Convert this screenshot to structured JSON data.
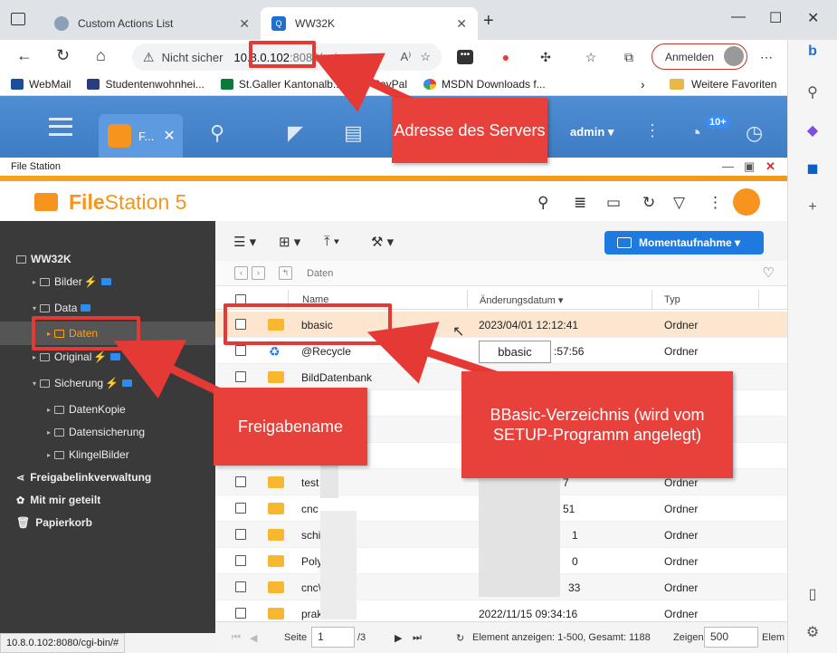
{
  "browser": {
    "tabs": [
      {
        "label": "Custom Actions List",
        "active": false
      },
      {
        "label": "WW32K",
        "active": true
      }
    ],
    "security_label": "Nicht sicher",
    "url_host": "10.8.0.102",
    "url_rest": ":8080/cgi...",
    "signin_label": "Anmelden",
    "favorites": [
      "WebMail",
      "Studentenwohnhei...",
      "St.Galler Kantonalb...",
      "PayPal",
      "MSDN Downloads f..."
    ],
    "favorites_folder": "Weitere Favoriten",
    "status_url": "10.8.0.102:8080/cgi-bin/#"
  },
  "qnap": {
    "app_tab_label": "F...",
    "user": "admin ▾",
    "badge": "10+"
  },
  "filestation": {
    "window_title": "File Station",
    "brand_bold": "File",
    "brand_rest": "Station 5",
    "snapshot_label": "Momentaufnahme ▾",
    "breadcrumb": "Daten",
    "columns": {
      "name": "Name",
      "date": "Änderungsdatum ▾",
      "type": "Typ"
    },
    "tree": {
      "root": "WW32K",
      "bilder": "Bilder",
      "data": "Data",
      "daten": "Daten",
      "original": "Original",
      "sicherung": "Sicherung",
      "datenkopie": "DatenKopie",
      "datensicherung": "Datensicherung",
      "klingelbilder": "KlingelBilder",
      "share_links": "Freigabelinkverwaltung",
      "shared_with_me": "Mit mir geteilt",
      "recycle": "Papierkorb"
    },
    "rows": [
      {
        "name": "bbasic",
        "date": "2023/04/01 12:12:41",
        "type": "Ordner"
      },
      {
        "name": "@Recycle",
        "date": ":57:56",
        "type": "Ordner"
      },
      {
        "name": "BildDatenbank",
        "date": "",
        "type": ""
      },
      {
        "name": "test",
        "date": "7",
        "type": "Ordner"
      },
      {
        "name": "cnc",
        "date": "51",
        "type": "Ordner"
      },
      {
        "name": "schi",
        "date": "1",
        "type": "Ordner"
      },
      {
        "name": "Poly",
        "date": "0",
        "type": "Ordner"
      },
      {
        "name": "cnc\\",
        "date": "33",
        "type": "Ordner"
      },
      {
        "name": "praktikant",
        "date": "2022/11/15 09:34:16",
        "type": "Ordner"
      }
    ],
    "tooltip": "bbasic",
    "footer": {
      "page_label": "Seite",
      "page_value": "1",
      "page_total": "/3",
      "summary": "Element anzeigen: 1-500, Gesamt: 1188",
      "show_label": "Zeigen",
      "show_value": "500",
      "elem_label": "Elem"
    }
  },
  "annotations": {
    "server_address": "Adresse des Servers",
    "share_name": "Freigabename",
    "bbasic_dir": "BBasic-Verzeichnis (wird vom SETUP-Programm angelegt)"
  },
  "colors": {
    "accent_orange": "#f7941d",
    "qnap_blue": "#4f8ed3",
    "annotation_red": "#e8403a",
    "highlight_row": "#fde6cf"
  }
}
